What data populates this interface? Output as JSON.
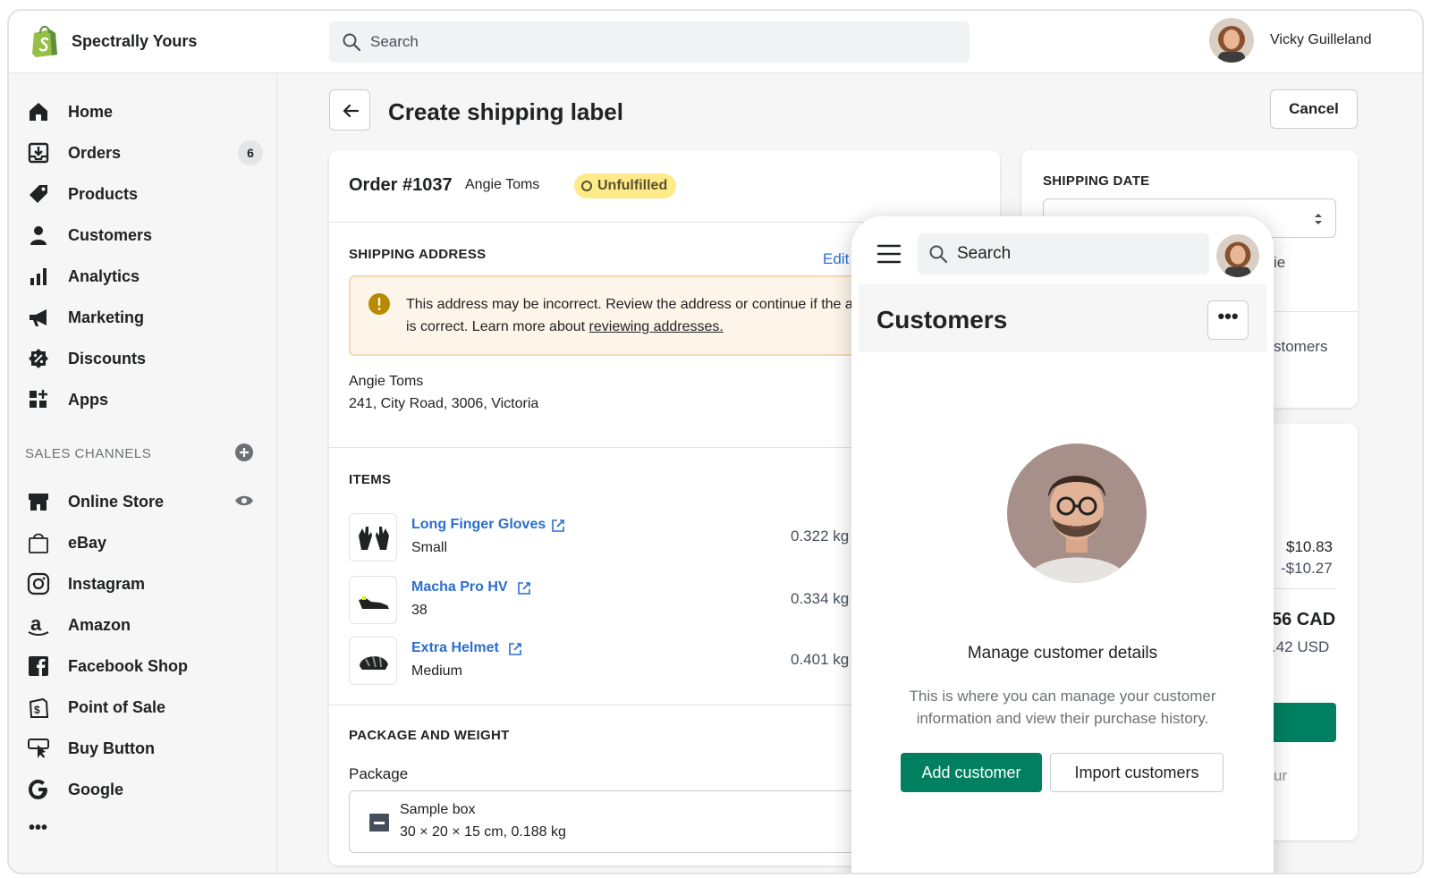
{
  "topbar": {
    "store_name": "Spectrally Yours",
    "search_placeholder": "Search",
    "user_name": "Vicky Guilleland"
  },
  "sidebar": {
    "items": [
      {
        "label": "Home",
        "icon": "home-icon"
      },
      {
        "label": "Orders",
        "icon": "orders-icon",
        "badge": "6"
      },
      {
        "label": "Products",
        "icon": "tag-icon"
      },
      {
        "label": "Customers",
        "icon": "person-icon"
      },
      {
        "label": "Analytics",
        "icon": "bar-chart-icon"
      },
      {
        "label": "Marketing",
        "icon": "megaphone-icon"
      },
      {
        "label": "Discounts",
        "icon": "discount-icon"
      },
      {
        "label": "Apps",
        "icon": "apps-icon"
      }
    ],
    "sales_channels_header": "SALES CHANNELS",
    "channels": [
      {
        "label": "Online Store",
        "icon": "store-icon"
      },
      {
        "label": "eBay",
        "icon": "shopping-bag-icon"
      },
      {
        "label": "Instagram",
        "icon": "instagram-icon"
      },
      {
        "label": "Amazon",
        "icon": "amazon-icon"
      },
      {
        "label": "Facebook Shop",
        "icon": "facebook-icon"
      },
      {
        "label": "Point of Sale",
        "icon": "pos-icon"
      },
      {
        "label": "Buy Button",
        "icon": "buy-button-icon"
      },
      {
        "label": "Google",
        "icon": "google-icon"
      }
    ],
    "more": "•••"
  },
  "page": {
    "title": "Create shipping label",
    "cancel_label": "Cancel"
  },
  "order": {
    "number": "Order #1037",
    "customer": "Angie Toms",
    "status": "Unfulfilled",
    "shipping_header": "SHIPPING ADDRESS",
    "edit_label": "Edit",
    "warning_text": "This address may be incorrect. Review the address or continue if the address is correct. Learn more about ",
    "warning_link": "reviewing addresses.",
    "address_name": "Angie Toms",
    "address_line": "241, City Road, 3006, Victoria",
    "items_header": "ITEMS",
    "items": [
      {
        "name": "Long Finger Gloves",
        "variant": "Small",
        "weight": "0.322 kg"
      },
      {
        "name": "Macha Pro HV",
        "variant": "38",
        "weight": "0.334 kg"
      },
      {
        "name": "Extra Helmet",
        "variant": "Medium",
        "weight": "0.401 kg"
      }
    ],
    "package_header": "PACKAGE AND WEIGHT",
    "package_label": "Package",
    "package_name": "Sample box",
    "package_dims": "30 × 20 × 15 cm, 0.188 kg"
  },
  "right_panel": {
    "shipping_date_header": "SHIPPING DATE",
    "partial_ie": "ie",
    "partial_customers": "stomers",
    "price_1": "$10.83",
    "price_2": "-$10.27",
    "total_cad": "56 CAD",
    "total_usd": ".42 USD",
    "partial_ur": "ur"
  },
  "phone": {
    "search_placeholder": "Search",
    "title": "Customers",
    "more": "•••",
    "heading": "Manage customer details",
    "description": "This is where you can manage your customer information and view their purchase history.",
    "add_button": "Add customer",
    "import_button": "Import customers"
  },
  "colors": {
    "brand_green": "#008060",
    "shopify_green": "#95bf47",
    "link_blue": "#2c6ecb",
    "badge_yellow": "#ffea8a",
    "warning_bg": "#fdf5e9"
  }
}
